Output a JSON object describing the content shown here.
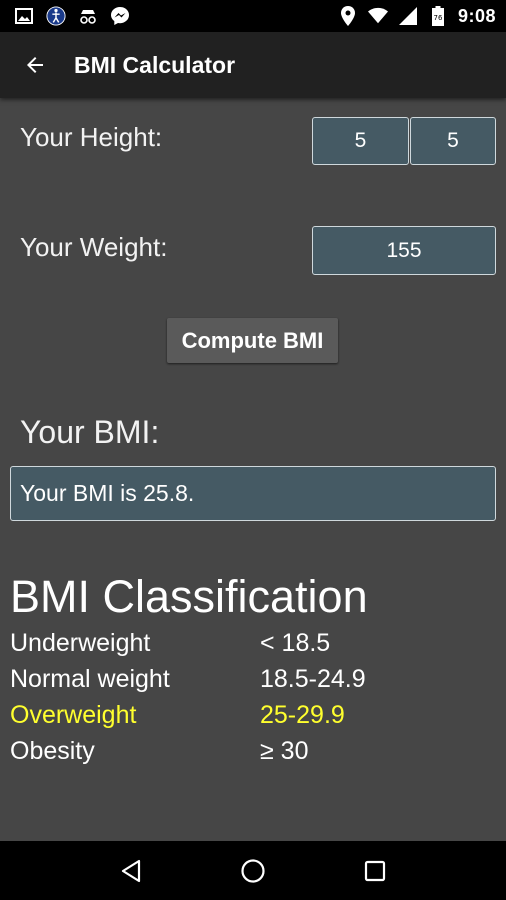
{
  "status_bar": {
    "time": "9:08",
    "icons": [
      "image-icon",
      "accessibility-icon",
      "incognito-icon",
      "messenger-icon",
      "location-icon",
      "wifi-icon",
      "signal-icon",
      "battery-icon"
    ]
  },
  "app_bar": {
    "title": "BMI Calculator"
  },
  "form": {
    "height_label": "Your Height:",
    "height_feet": "5",
    "height_inches": "5",
    "weight_label": "Your Weight:",
    "weight_value": "155",
    "compute_label": "Compute BMI"
  },
  "result": {
    "heading": "Your BMI:",
    "text": "Your BMI is 25.8."
  },
  "classification": {
    "heading": "BMI Classification",
    "rows": [
      {
        "name": "Underweight",
        "range": "< 18.5",
        "color": "#ffffff"
      },
      {
        "name": "Normal weight",
        "range": "18.5-24.9",
        "color": "#ffffff"
      },
      {
        "name": "Overweight",
        "range": "25-29.9",
        "color": "#ffff2e"
      },
      {
        "name": "Obesity",
        "range": "≥ 30",
        "color": "#ffffff"
      }
    ]
  },
  "colors": {
    "background": "#464646",
    "app_bar": "#212121",
    "field": "#455a64",
    "highlight": "#ffff2e"
  }
}
